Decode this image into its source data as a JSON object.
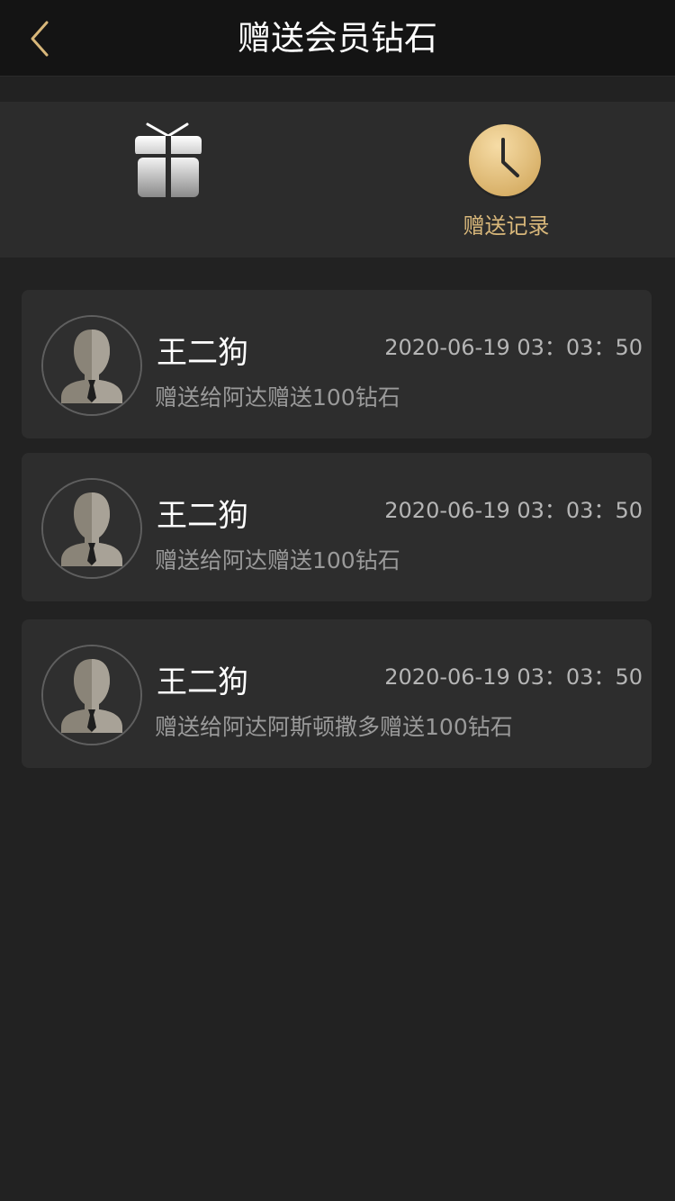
{
  "header": {
    "title": "赠送会员钻石"
  },
  "tabs": {
    "gift": {
      "label": ""
    },
    "record": {
      "label": "赠送记录"
    }
  },
  "records": [
    {
      "name": "王二狗",
      "time": "2020-06-19 03：03：50",
      "desc": "赠送给阿达赠送100钻石"
    },
    {
      "name": "王二狗",
      "time": "2020-06-19 03：03：50",
      "desc": "赠送给阿达赠送100钻石"
    },
    {
      "name": "王二狗",
      "time": "2020-06-19 03：03：50",
      "desc": "赠送给阿达阿斯顿撒多赠送100钻石"
    }
  ],
  "colors": {
    "background": "#222222",
    "navbar": "#141414",
    "card": "#2d2d2d",
    "accent_gold": "#d8b77a"
  },
  "icons": {
    "back": "chevron-left-icon",
    "gift": "gift-icon",
    "record": "clock-icon",
    "avatar": "default-avatar-icon"
  }
}
